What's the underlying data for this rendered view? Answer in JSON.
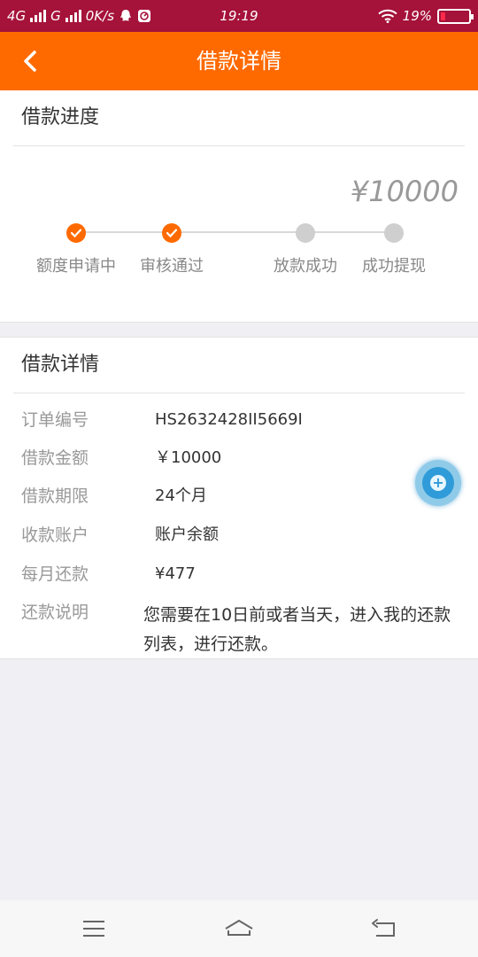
{
  "status_bar": {
    "network1": "4G",
    "network2": "G",
    "speed": "0K/s",
    "time": "19:19",
    "battery_percent": "19%",
    "battery_level": 0.19,
    "icons": [
      "signal-icon",
      "qq-icon",
      "app-notification-icon",
      "wifi-icon",
      "battery-icon"
    ]
  },
  "header": {
    "title": "借款详情",
    "back_icon": "chevron-left-icon",
    "color": "#ff6a00"
  },
  "progress_card": {
    "title": "借款进度",
    "amount": "¥10000",
    "steps": [
      {
        "label": "额度申请中",
        "done": true
      },
      {
        "label": "审核通过",
        "done": true
      },
      {
        "label": "放款成功",
        "done": false
      },
      {
        "label": "成功提现",
        "done": false
      }
    ]
  },
  "detail_card": {
    "title": "借款详情",
    "rows": [
      {
        "key": "订单编号",
        "value": "HS2632428II5669I"
      },
      {
        "key": "借款金额",
        "value": "￥10000"
      },
      {
        "key": "借款期限",
        "value": "24个月"
      },
      {
        "key": "收款账户",
        "value": "账户余额"
      },
      {
        "key": "每月还款",
        "value": "¥477"
      }
    ],
    "note_key": "还款说明",
    "note_value": "您需要在10日前或者当天，进入我的还款列表，进行还款。"
  },
  "floating_button": {
    "icon": "plus-icon"
  },
  "nav_bar": {
    "icons": [
      "menu-icon",
      "home-icon",
      "back-icon"
    ]
  }
}
